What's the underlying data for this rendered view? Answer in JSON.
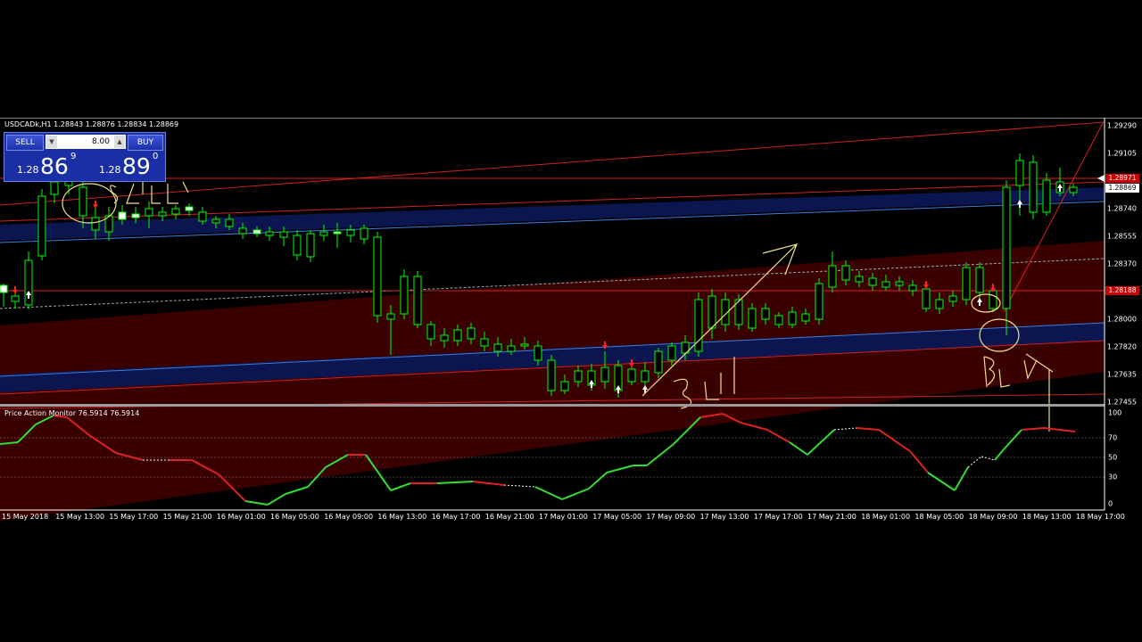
{
  "chart": {
    "title": "USDCADk,H1  1.28843 1.28876 1.28834 1.28869",
    "indicator_title": "Price Action Monitor 76.5914 76.5914",
    "price_labels": [
      "1.29290",
      "1.29105",
      "1.28740",
      "1.28555",
      "1.28370",
      "1.28000",
      "1.27820",
      "1.27635",
      "1.27455"
    ],
    "tag_upper": "1.28971",
    "tag_current": "1.28869",
    "tag_lower": "1.28188",
    "indicator_levels": [
      "100",
      "70",
      "50",
      "30",
      "0"
    ],
    "time_labels": [
      "15 May 2018",
      "15 May 13:00",
      "15 May 17:00",
      "15 May 21:00",
      "16 May 01:00",
      "16 May 05:00",
      "16 May 09:00",
      "16 May 13:00",
      "16 May 17:00",
      "16 May 21:00",
      "17 May 01:00",
      "17 May 05:00",
      "17 May 09:00",
      "17 May 13:00",
      "17 May 17:00",
      "17 May 21:00",
      "18 May 01:00",
      "18 May 05:00",
      "18 May 09:00",
      "18 May 13:00",
      "18 May 17:00"
    ]
  },
  "trade_panel": {
    "sell_label": "SELL",
    "buy_label": "BUY",
    "lot": "8.00",
    "sell_small": "1.28",
    "sell_big": "86",
    "sell_sup": "9",
    "buy_small": "1.28",
    "buy_big": "89",
    "buy_sup": "0"
  },
  "annotations": [
    "SELL",
    "BUY",
    "BUY"
  ],
  "colors": {
    "bull": "#ffffff",
    "bear": "#000000",
    "wick": "#00ff00",
    "up_line": "#33dd33",
    "down_line": "#dd2222",
    "band": "#3a0000",
    "channel": "#0a1a5a"
  }
}
